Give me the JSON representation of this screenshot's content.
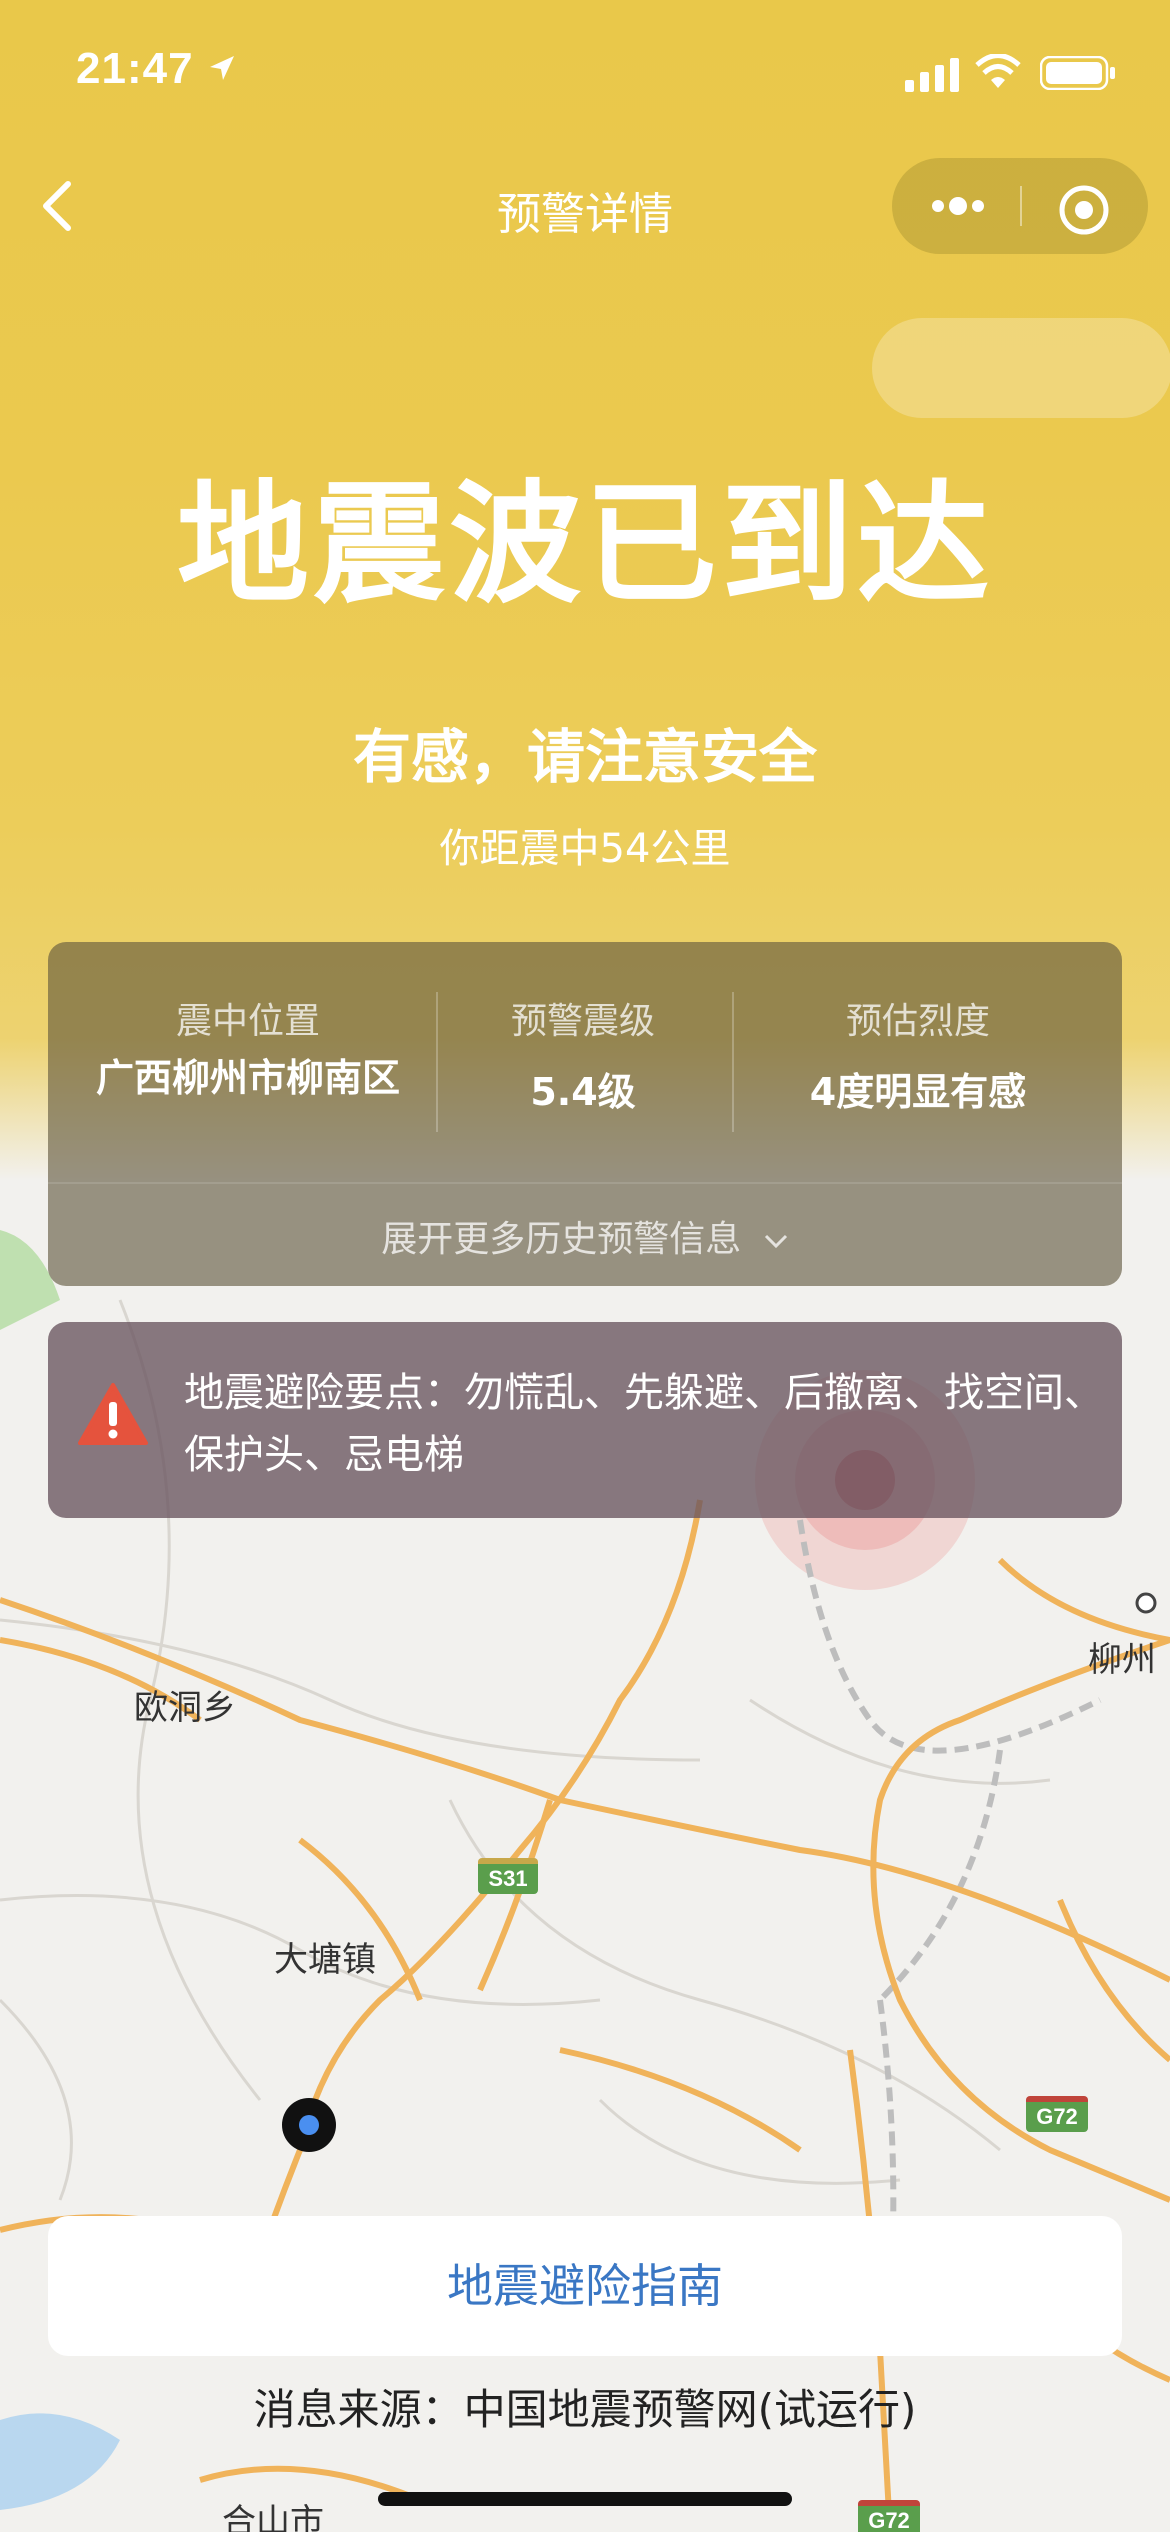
{
  "status_bar": {
    "time": "21:47",
    "icons": [
      "location-arrow-icon",
      "signal-icon",
      "wifi-icon",
      "battery-icon"
    ]
  },
  "nav": {
    "title": "预警详情",
    "icons": [
      "back-icon",
      "more-icon",
      "target-icon"
    ]
  },
  "alert": {
    "headline": "地震波已到达",
    "subtitle": "有感，请注意安全",
    "distance": "你距震中54公里"
  },
  "info": {
    "epicenter_label": "震中位置",
    "epicenter_value": "广西柳州市柳南区",
    "magnitude_label": "预警震级",
    "magnitude_value": "5.4级",
    "intensity_label": "预估烈度",
    "intensity_value": "4度明显有感",
    "expand_label": "展开更多历史预警信息"
  },
  "tips": {
    "text": "地震避险要点：勿慌乱、先躲避、后撤离、找空间、保护头、忌电梯"
  },
  "map": {
    "labels": {
      "oudong": "欧洞乡",
      "datang": "大塘镇",
      "liuzhou": "柳州",
      "heshan": "合山市"
    },
    "shields": {
      "s31": "S31",
      "g72a": "G72",
      "g72b": "G72"
    }
  },
  "footer": {
    "guide_button": "地震避险指南",
    "source": "消息来源：中国地震预警网(试运行)"
  },
  "colors": {
    "header_yellow": "#e9c84a",
    "road_orange": "#f0b35a",
    "guide_blue": "#3a77c4",
    "warning_red": "#e5533d"
  }
}
